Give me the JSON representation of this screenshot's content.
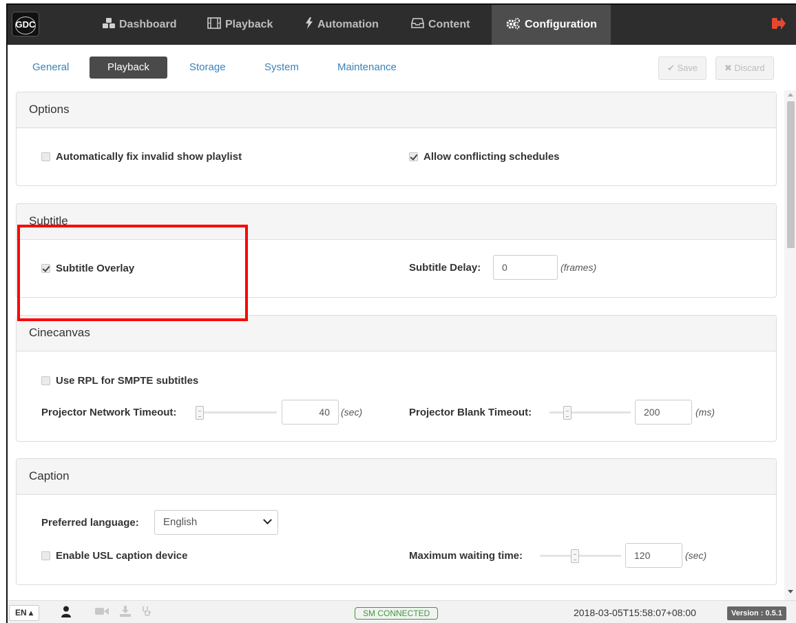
{
  "nav": {
    "logo": "GDC",
    "items": [
      {
        "label": "Dashboard",
        "icon": "cubes-icon"
      },
      {
        "label": "Playback",
        "icon": "film-icon"
      },
      {
        "label": "Automation",
        "icon": "bolt-icon"
      },
      {
        "label": "Content",
        "icon": "inbox-icon"
      },
      {
        "label": "Configuration",
        "icon": "cogs-icon",
        "active": true
      }
    ]
  },
  "subnav": {
    "tabs": [
      {
        "label": "General"
      },
      {
        "label": "Playback",
        "active": true
      },
      {
        "label": "Storage"
      },
      {
        "label": "System"
      },
      {
        "label": "Maintenance"
      }
    ],
    "save_label": "✔ Save",
    "discard_label": "✖ Discard"
  },
  "options": {
    "title": "Options",
    "auto_fix_label": "Automatically fix invalid show playlist",
    "auto_fix_checked": false,
    "allow_conflict_label": "Allow conflicting schedules",
    "allow_conflict_checked": true
  },
  "subtitle": {
    "title": "Subtitle",
    "overlay_label": "Subtitle Overlay",
    "overlay_checked": true,
    "delay_label": "Subtitle Delay:",
    "delay_value": "0",
    "delay_unit": "(frames)"
  },
  "cinecanvas": {
    "title": "Cinecanvas",
    "rpl_label": "Use RPL for SMPTE subtitles",
    "rpl_checked": false,
    "network_timeout_label": "Projector Network Timeout:",
    "network_timeout_value": "40",
    "network_timeout_unit": "(sec)",
    "blank_timeout_label": "Projector Blank Timeout:",
    "blank_timeout_value": "200",
    "blank_timeout_unit": "(ms)"
  },
  "caption": {
    "title": "Caption",
    "language_label": "Preferred language:",
    "language_value": "English",
    "usl_label": "Enable USL caption device",
    "usl_checked": false,
    "max_wait_label": "Maximum waiting time:",
    "max_wait_value": "120",
    "max_wait_unit": "(sec)"
  },
  "footer": {
    "lang": "EN ▴",
    "status": "SM CONNECTED",
    "timestamp": "2018-03-05T15:58:07+08:00",
    "version": "Version : 0.5.1"
  },
  "colors": {
    "navbar": "#2d2d2d",
    "accent_link": "#3b82b8",
    "logout": "#e8472f",
    "status_ok": "#3a9a3a",
    "highlight": "#ff0000"
  }
}
